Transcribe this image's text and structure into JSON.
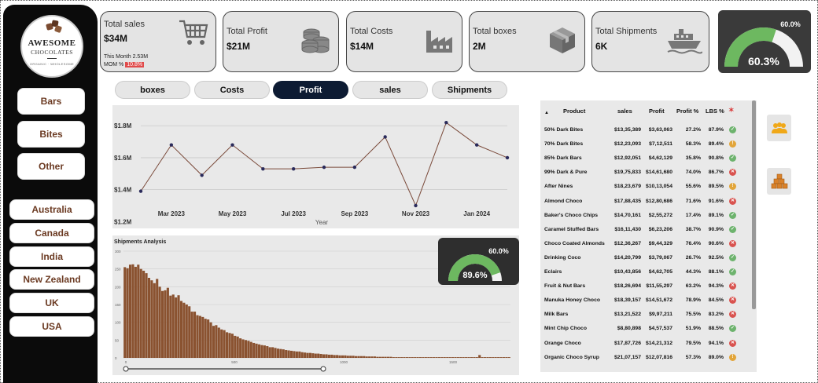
{
  "brand": {
    "line1": "AWESOME",
    "line2": "CHOCOLATES",
    "line3": "ORGANIC · WHOLESOME"
  },
  "product_buttons": [
    "Bars",
    "Bites",
    "Other"
  ],
  "geo_buttons": [
    "Australia",
    "Canada",
    "India",
    "New Zealand",
    "UK",
    "USA"
  ],
  "kpis": {
    "sales": {
      "label": "Total sales",
      "value": "$34M",
      "month": "This Month 2.53M",
      "mom_label": "MOM %",
      "mom_value": "10.8%",
      "icon": "shopping-cart-icon"
    },
    "profit": {
      "label": "Total Profit",
      "value": "$21M",
      "icon": "coins-icon"
    },
    "costs": {
      "label": "Total Costs",
      "value": "$14M",
      "icon": "factory-icon"
    },
    "boxes": {
      "label": "Total boxes",
      "value": "2M",
      "icon": "box-icon"
    },
    "shipments": {
      "label": "Total Shipments",
      "value": "6K",
      "icon": "ship-icon"
    }
  },
  "top_gauge": {
    "target": "60.0%",
    "value": "60.3%",
    "fill": 0.603,
    "color": "#6db860"
  },
  "tabs": [
    {
      "label": "boxes",
      "active": false
    },
    {
      "label": "Costs",
      "active": false
    },
    {
      "label": "Profit",
      "active": true
    },
    {
      "label": "sales",
      "active": false
    },
    {
      "label": "Shipments",
      "active": false
    }
  ],
  "chart_data": [
    {
      "type": "line",
      "xlabel": "Year",
      "ylabel": "",
      "ylim": [
        1.28,
        1.87
      ],
      "y_ticks": [
        "$1.2M",
        "$1.4M",
        "$1.6M",
        "$1.8M"
      ],
      "x_ticks": [
        "Mar 2023",
        "May 2023",
        "Jul 2023",
        "Sep 2023",
        "Nov 2023",
        "Jan 2024"
      ],
      "series": [
        {
          "values": [
            1.39,
            1.68,
            1.49,
            1.68,
            1.53,
            1.53,
            1.54,
            1.54,
            1.73,
            1.3,
            1.82,
            1.68,
            1.6
          ]
        }
      ],
      "line_color": "#7a4a3a",
      "grid": true
    },
    {
      "type": "bar",
      "title": "Shipments Analysis",
      "y_ticks": [
        "0",
        "50",
        "100",
        "150",
        "200",
        "250",
        "300"
      ],
      "x_ticks": [
        "0",
        "500",
        "1000",
        "1500"
      ],
      "ylim": [
        0,
        300
      ],
      "bar_color": "#8a5230",
      "values": [
        255,
        252,
        262,
        263,
        256,
        262,
        250,
        245,
        238,
        225,
        218,
        210,
        222,
        200,
        188,
        190,
        197,
        175,
        178,
        170,
        176,
        160,
        155,
        150,
        145,
        130,
        130,
        120,
        118,
        115,
        110,
        108,
        100,
        90,
        92,
        85,
        80,
        78,
        72,
        70,
        68,
        62,
        60,
        55,
        52,
        50,
        48,
        45,
        42,
        40,
        38,
        36,
        35,
        33,
        30,
        30,
        28,
        26,
        25,
        24,
        22,
        21,
        20,
        19,
        18,
        18,
        16,
        15,
        14,
        14,
        13,
        12,
        12,
        11,
        10,
        10,
        9,
        9,
        8,
        8,
        7,
        7,
        7,
        6,
        6,
        6,
        5,
        5,
        5,
        5,
        4,
        4,
        4,
        4,
        3,
        3,
        3,
        3,
        3,
        3,
        2,
        2,
        2,
        2,
        2,
        2,
        2,
        2,
        2,
        2,
        2,
        2,
        2,
        2,
        2,
        2,
        2,
        2,
        2,
        2,
        2,
        2,
        2,
        2,
        2,
        2,
        2,
        2,
        2,
        2,
        2,
        2,
        8,
        2,
        2,
        2,
        2,
        2,
        2,
        2,
        2,
        2,
        2,
        2
      ]
    }
  ],
  "ship_gauge": {
    "target": "60.0%",
    "value": "89.6%",
    "fill": 0.896,
    "color": "#6db860"
  },
  "table": {
    "headers": [
      "Product",
      "sales",
      "Profit",
      "Profit %",
      "LBS %"
    ],
    "rows": [
      {
        "product": "50% Dark Bites",
        "sales": "$13,35,389",
        "profit": "$3,63,063",
        "pct": "27.2%",
        "lbs": "87.9%",
        "status": "green"
      },
      {
        "product": "70% Dark Bites",
        "sales": "$12,23,093",
        "profit": "$7,12,511",
        "pct": "58.3%",
        "lbs": "89.4%",
        "status": "yellow"
      },
      {
        "product": "85% Dark Bars",
        "sales": "$12,92,051",
        "profit": "$4,62,129",
        "pct": "35.8%",
        "lbs": "90.8%",
        "status": "green"
      },
      {
        "product": "99% Dark & Pure",
        "sales": "$19,75,833",
        "profit": "$14,61,680",
        "pct": "74.0%",
        "lbs": "86.7%",
        "status": "red"
      },
      {
        "product": "After Nines",
        "sales": "$18,23,679",
        "profit": "$10,13,054",
        "pct": "55.6%",
        "lbs": "89.5%",
        "status": "yellow"
      },
      {
        "product": "Almond Choco",
        "sales": "$17,88,435",
        "profit": "$12,80,686",
        "pct": "71.6%",
        "lbs": "91.6%",
        "status": "red"
      },
      {
        "product": "Baker's Choco Chips",
        "sales": "$14,70,161",
        "profit": "$2,55,272",
        "pct": "17.4%",
        "lbs": "89.1%",
        "status": "green"
      },
      {
        "product": "Caramel Stuffed Bars",
        "sales": "$16,11,430",
        "profit": "$6,23,206",
        "pct": "38.7%",
        "lbs": "90.9%",
        "status": "green"
      },
      {
        "product": "Choco Coated Almonds",
        "sales": "$12,36,267",
        "profit": "$9,44,329",
        "pct": "76.4%",
        "lbs": "90.6%",
        "status": "red"
      },
      {
        "product": "Drinking Coco",
        "sales": "$14,20,799",
        "profit": "$3,79,067",
        "pct": "26.7%",
        "lbs": "92.5%",
        "status": "green"
      },
      {
        "product": "Eclairs",
        "sales": "$10,43,856",
        "profit": "$4,62,705",
        "pct": "44.3%",
        "lbs": "88.1%",
        "status": "green"
      },
      {
        "product": "Fruit & Nut Bars",
        "sales": "$18,26,694",
        "profit": "$11,55,297",
        "pct": "63.2%",
        "lbs": "94.3%",
        "status": "red"
      },
      {
        "product": "Manuka Honey Choco",
        "sales": "$18,39,157",
        "profit": "$14,51,672",
        "pct": "78.9%",
        "lbs": "84.5%",
        "status": "red"
      },
      {
        "product": "Milk Bars",
        "sales": "$13,21,522",
        "profit": "$9,97,211",
        "pct": "75.5%",
        "lbs": "83.2%",
        "status": "red"
      },
      {
        "product": "Mint Chip Choco",
        "sales": "$8,80,898",
        "profit": "$4,57,537",
        "pct": "51.9%",
        "lbs": "88.5%",
        "status": "green"
      },
      {
        "product": "Orange Choco",
        "sales": "$17,87,726",
        "profit": "$14,21,312",
        "pct": "79.5%",
        "lbs": "94.1%",
        "status": "red"
      },
      {
        "product": "Organic Choco Syrup",
        "sales": "$21,07,157",
        "profit": "$12,07,816",
        "pct": "57.3%",
        "lbs": "89.0%",
        "status": "yellow"
      }
    ]
  },
  "side_icons": [
    "people-icon",
    "boxes-stack-icon"
  ]
}
